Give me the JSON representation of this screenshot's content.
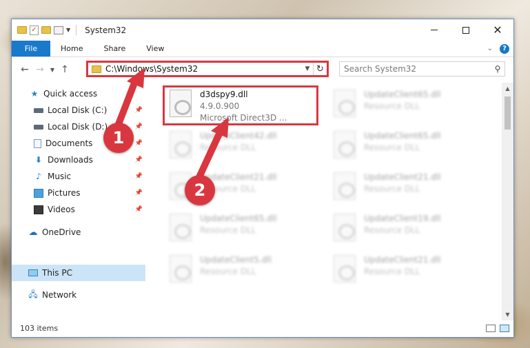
{
  "window": {
    "title": "System32"
  },
  "ribbon": {
    "tabs": [
      "File",
      "Home",
      "Share",
      "View"
    ],
    "help": "?"
  },
  "navbar": {
    "address": "C:\\Windows\\System32",
    "search_placeholder": "Search System32"
  },
  "sidebar": {
    "items": [
      {
        "label": "Quick access",
        "icon": "star-icon"
      },
      {
        "label": "Local Disk (C:)",
        "icon": "disk-icon",
        "pinned": true
      },
      {
        "label": "Local Disk (D:)",
        "icon": "disk-icon",
        "pinned": true
      },
      {
        "label": "Documents",
        "icon": "document-icon",
        "pinned": true
      },
      {
        "label": "Downloads",
        "icon": "download-icon",
        "pinned": true
      },
      {
        "label": "Music",
        "icon": "music-icon",
        "pinned": true
      },
      {
        "label": "Pictures",
        "icon": "picture-icon",
        "pinned": true
      },
      {
        "label": "Videos",
        "icon": "video-icon",
        "pinned": true
      },
      {
        "label": "OneDrive",
        "icon": "cloud-icon"
      },
      {
        "label": "This PC",
        "icon": "computer-icon",
        "selected": true
      },
      {
        "label": "Network",
        "icon": "network-icon"
      }
    ]
  },
  "files": [
    {
      "name": "d3dspy9.dll",
      "sub1": "4.9.0.900",
      "sub2": "Microsoft Direct3D ...",
      "highlighted": true
    },
    {
      "name": "UpdateClient65.dll",
      "sub1": "Resource DLL"
    },
    {
      "name": "UpdateClient42.dll",
      "sub1": "Resource DLL"
    },
    {
      "name": "UpdateClient65.dll",
      "sub1": "Resource DLL"
    },
    {
      "name": "UpdateClient21.dll",
      "sub1": "Resource DLL"
    },
    {
      "name": "UpdateClient21.dll",
      "sub1": "Resource DLL"
    },
    {
      "name": "UpdateClient65.dll",
      "sub1": "Resource DLL"
    },
    {
      "name": "UpdateClient19.dll",
      "sub1": "Resource DLL"
    },
    {
      "name": "UpdateClient5.dll",
      "sub1": "Resource DLL"
    },
    {
      "name": "UpdateClient21.dll",
      "sub1": "Resource DLL"
    }
  ],
  "status": {
    "items_count": "103 items"
  },
  "callouts": {
    "step1": "1",
    "step2": "2",
    "color": "#d9373f"
  }
}
